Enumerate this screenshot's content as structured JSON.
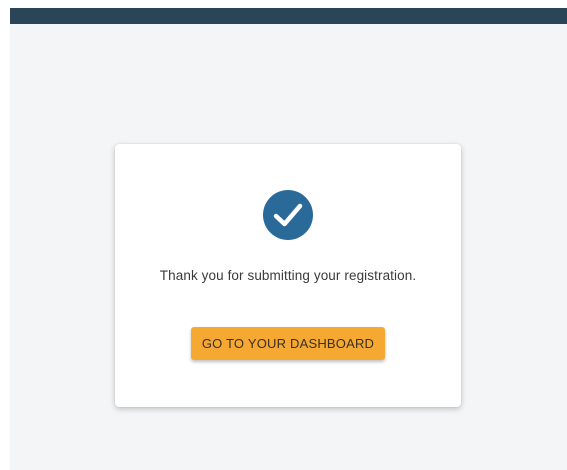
{
  "card": {
    "icon": "check-circle-icon",
    "message": "Thank you for submitting your registration.",
    "button_label": "GO TO YOUR DASHBOARD"
  },
  "colors": {
    "topbar": "#2a4558",
    "icon": "#2a6a99",
    "button": "#f5a832",
    "background": "#f4f5f6"
  }
}
